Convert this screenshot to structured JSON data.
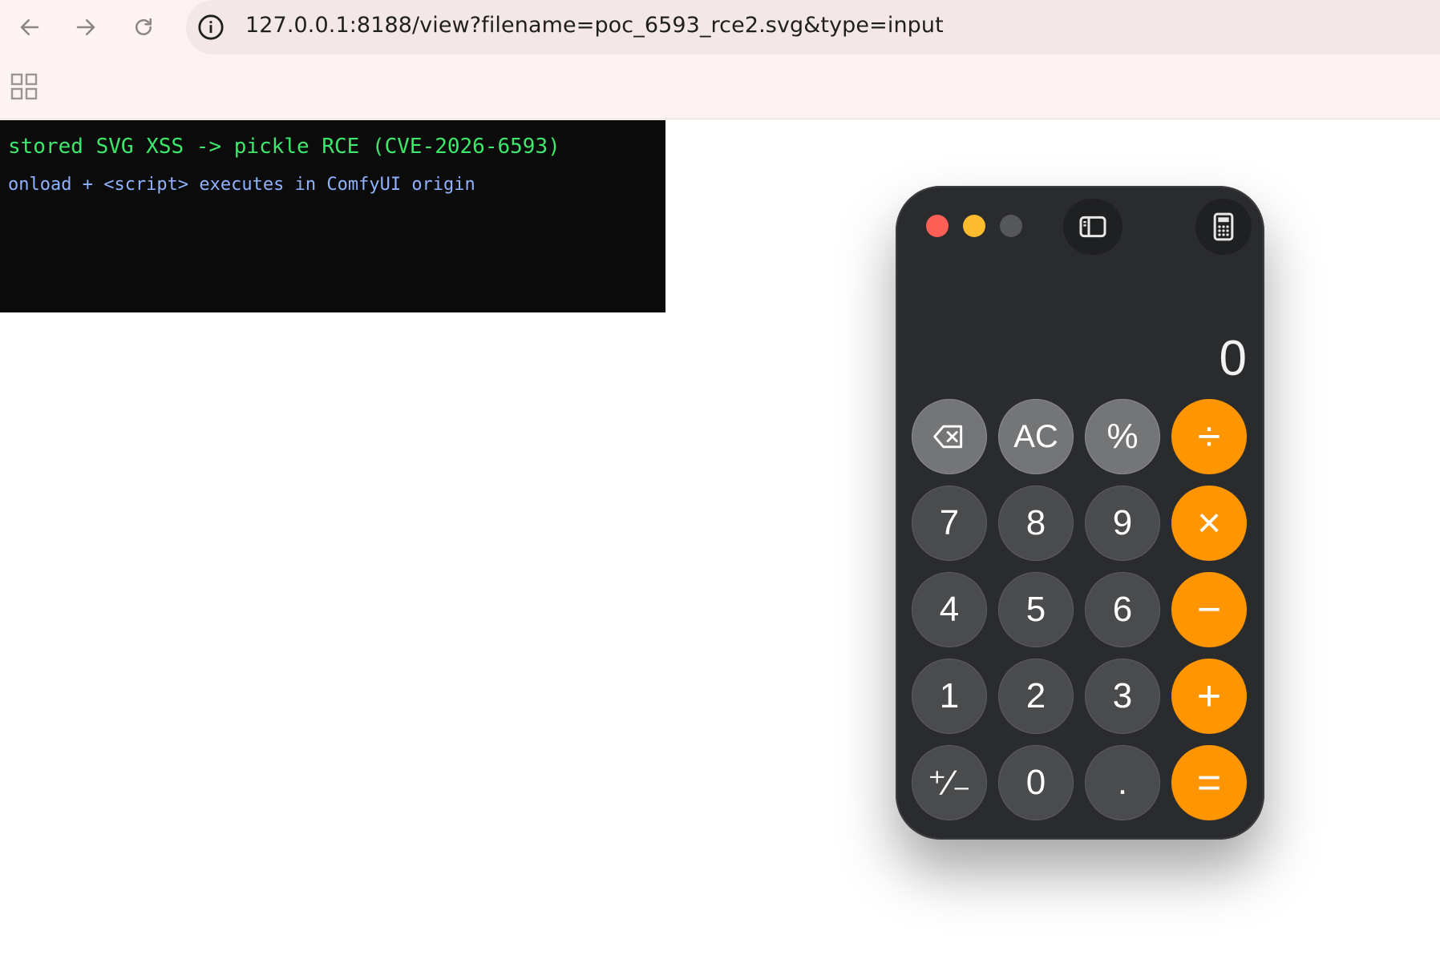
{
  "browser": {
    "url": "127.0.0.1:8188/view?filename=poc_6593_rce2.svg&type=input",
    "back_icon": "arrow-left-icon",
    "forward_icon": "arrow-right-icon",
    "reload_icon": "reload-icon",
    "site_info_icon": "info-icon",
    "apps_icon": "apps-grid-icon"
  },
  "terminal": {
    "title": "stored SVG XSS -> pickle RCE (CVE-2026-6593)",
    "subtitle": "onload + <script> executes in ComfyUI origin",
    "title_color": "#3ee86b",
    "subtitle_color": "#8fb3ff"
  },
  "calculator": {
    "display": "0",
    "toolbar": {
      "sidebar_icon": "sidebar-icon",
      "mode_icon": "calculator-icon"
    },
    "keys": [
      {
        "label": "",
        "icon": "backspace-icon",
        "kind": "func",
        "name": "backspace-key"
      },
      {
        "label": "AC",
        "kind": "func",
        "name": "clear-key"
      },
      {
        "label": "%",
        "kind": "func",
        "name": "percent-key"
      },
      {
        "label": "÷",
        "kind": "op",
        "name": "divide-key"
      },
      {
        "label": "7",
        "kind": "dark",
        "name": "digit-7-key"
      },
      {
        "label": "8",
        "kind": "dark",
        "name": "digit-8-key"
      },
      {
        "label": "9",
        "kind": "dark",
        "name": "digit-9-key"
      },
      {
        "label": "×",
        "kind": "op",
        "name": "multiply-key"
      },
      {
        "label": "4",
        "kind": "dark",
        "name": "digit-4-key"
      },
      {
        "label": "5",
        "kind": "dark",
        "name": "digit-5-key"
      },
      {
        "label": "6",
        "kind": "dark",
        "name": "digit-6-key"
      },
      {
        "label": "−",
        "kind": "op",
        "name": "subtract-key"
      },
      {
        "label": "1",
        "kind": "dark",
        "name": "digit-1-key"
      },
      {
        "label": "2",
        "kind": "dark",
        "name": "digit-2-key"
      },
      {
        "label": "3",
        "kind": "dark",
        "name": "digit-3-key"
      },
      {
        "label": "+",
        "kind": "op",
        "name": "add-key"
      },
      {
        "label": "⁺∕₋",
        "kind": "dark",
        "name": "plus-minus-key"
      },
      {
        "label": "0",
        "kind": "dark",
        "name": "digit-0-key"
      },
      {
        "label": ".",
        "kind": "dark",
        "name": "decimal-key"
      },
      {
        "label": "=",
        "kind": "op",
        "name": "equals-key"
      }
    ],
    "colors": {
      "operator": "#ff9500",
      "function": "#747577",
      "digit": "#4a4b4d",
      "body": "#2a2b2d"
    }
  }
}
